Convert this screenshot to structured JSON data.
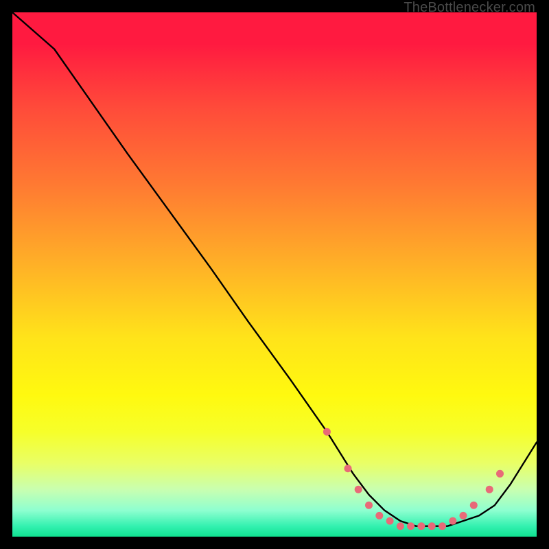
{
  "watermark": "TheBottlenecker.com",
  "chart_data": {
    "type": "line",
    "title": "",
    "xlabel": "",
    "ylabel": "",
    "xlim": [
      0,
      100
    ],
    "ylim": [
      0,
      100
    ],
    "x": [
      0,
      8,
      15,
      22,
      30,
      38,
      45,
      53,
      60,
      65,
      68,
      71,
      74,
      77,
      80,
      83,
      86,
      89,
      92,
      95,
      100
    ],
    "values": [
      100,
      93,
      83,
      73,
      62,
      51,
      41,
      30,
      20,
      12,
      8,
      5,
      3,
      2,
      2,
      2,
      3,
      4,
      6,
      10,
      18
    ],
    "marker_points": [
      {
        "x": 60,
        "y": 20
      },
      {
        "x": 64,
        "y": 13
      },
      {
        "x": 66,
        "y": 9
      },
      {
        "x": 68,
        "y": 6
      },
      {
        "x": 70,
        "y": 4
      },
      {
        "x": 72,
        "y": 3
      },
      {
        "x": 74,
        "y": 2
      },
      {
        "x": 76,
        "y": 2
      },
      {
        "x": 78,
        "y": 2
      },
      {
        "x": 80,
        "y": 2
      },
      {
        "x": 82,
        "y": 2
      },
      {
        "x": 84,
        "y": 3
      },
      {
        "x": 86,
        "y": 4
      },
      {
        "x": 88,
        "y": 6
      },
      {
        "x": 91,
        "y": 9
      },
      {
        "x": 93,
        "y": 12
      }
    ],
    "line_color": "#000000",
    "marker_color": "#e86a78",
    "background": "traffic-gradient"
  }
}
